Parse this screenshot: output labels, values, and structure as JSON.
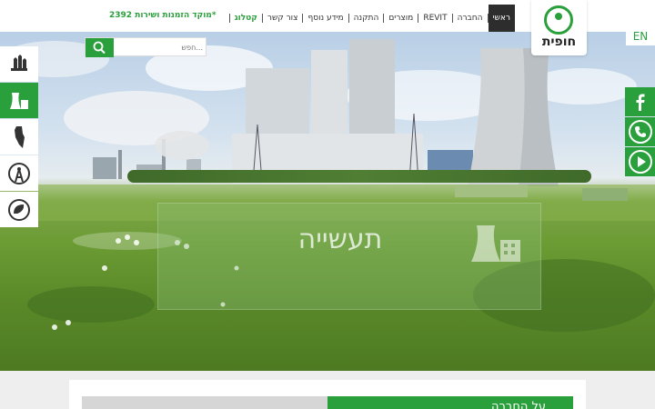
{
  "header": {
    "hotline": "מוקד הזמנות ושירות 2392*",
    "nav": [
      {
        "label": "ראשי",
        "state": "active"
      },
      {
        "label": "החברה",
        "state": ""
      },
      {
        "label": "REVIT",
        "state": ""
      },
      {
        "label": "מוצרים",
        "state": ""
      },
      {
        "label": "התקנה",
        "state": ""
      },
      {
        "label": "מידע נוסף",
        "state": ""
      },
      {
        "label": "צור קשר",
        "state": ""
      },
      {
        "label": "קטלוג",
        "state": "green"
      }
    ],
    "logo_text": "חופית"
  },
  "search": {
    "placeholder": "חפש..."
  },
  "language_toggle": "EN",
  "categories": [
    {
      "icon": "agriculture-icon",
      "active": false
    },
    {
      "icon": "industry-icon",
      "active": true
    },
    {
      "icon": "map-icon",
      "active": false
    },
    {
      "icon": "antenna-icon",
      "active": false
    },
    {
      "icon": "recycle-icon",
      "active": false
    }
  ],
  "social": [
    "facebook-icon",
    "phone-icon",
    "youtube-icon"
  ],
  "hero": {
    "title": "תעשייה",
    "icon": "factory-icon"
  },
  "about": {
    "title": "על החברה"
  },
  "colors": {
    "accent": "#2aa03c",
    "active_nav": "#2d2d2d"
  }
}
